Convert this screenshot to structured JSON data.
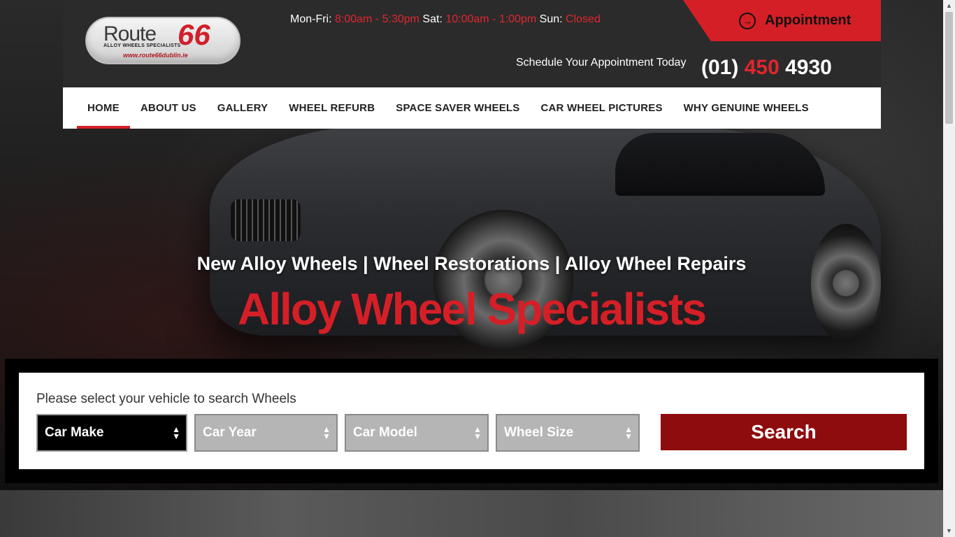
{
  "header": {
    "logo": {
      "name": "Route",
      "number": "66",
      "subtitle": "ALLOY WHEELS SPECIALISTS",
      "url": "www.route66dublin.ie"
    },
    "hours": {
      "weekday_label": "Mon-Fri:",
      "weekday_time": "8:00am - 5:30pm",
      "sat_label": "Sat:",
      "sat_time": "10:00am - 1:00pm",
      "sun_label": "Sun:",
      "sun_time": "Closed"
    },
    "appointment_label": "Appointment",
    "schedule_text": "Schedule Your Appointment Today",
    "phone": {
      "part1": "(01)",
      "part2": "450",
      "part3": "4930"
    }
  },
  "nav": {
    "items": [
      {
        "label": "HOME",
        "active": true
      },
      {
        "label": "ABOUT US"
      },
      {
        "label": "GALLERY"
      },
      {
        "label": "WHEEL REFURB"
      },
      {
        "label": "SPACE SAVER WHEELS"
      },
      {
        "label": "CAR WHEEL PICTURES"
      },
      {
        "label": "WHY GENUINE WHEELS"
      }
    ]
  },
  "hero": {
    "tagline": "New Alloy Wheels | Wheel Restorations | Alloy Wheel Repairs",
    "title": "Alloy Wheel Specialists"
  },
  "search": {
    "prompt": "Please select your vehicle to search Wheels",
    "selects": [
      {
        "label": "Car Make"
      },
      {
        "label": "Car Year"
      },
      {
        "label": "Car Model"
      },
      {
        "label": "Wheel Size"
      }
    ],
    "button_label": "Search"
  },
  "colors": {
    "accent": "#d51f27",
    "search_button": "#8e0b0e",
    "header_bg": "#2b2b2b"
  }
}
